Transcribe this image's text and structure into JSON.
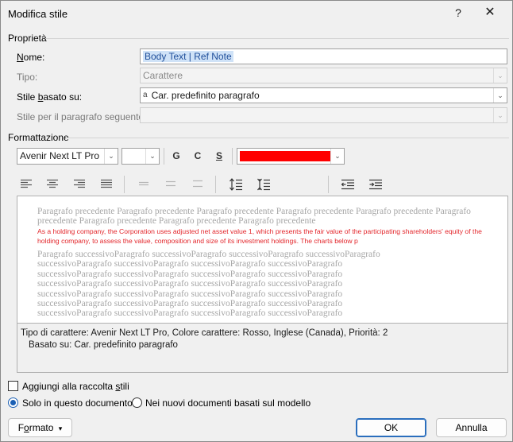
{
  "window": {
    "title": "Modifica stile",
    "help_glyph": "?",
    "close_glyph": "✕"
  },
  "properties": {
    "section": "Proprietà",
    "name_label": "Nome:",
    "name_value": "Body Text | Ref Note",
    "type_label": "Tipo:",
    "type_value": "Carattere",
    "based_label_pre": "Stile ",
    "based_label_u": "b",
    "based_label_post": "asato su:",
    "based_glyph": "a",
    "based_value": "Car. predefinito paragrafo",
    "next_label": "Stile per il paragrafo seguente:",
    "next_value": ""
  },
  "formatting": {
    "section": "Formattazione",
    "font": "Avenir Next LT Pro",
    "size": "",
    "bold": "G",
    "italic": "C",
    "underline": "S",
    "color": "#ff0000",
    "accent": "#1a5fb4"
  },
  "preview": {
    "prev_text": "Paragrafo precedente Paragrafo precedente Paragrafo precedente Paragrafo precedente Paragrafo precedente Paragrafo precedente Paragrafo precedente Paragrafo precedente Paragrafo precedente",
    "sample_text": "As a holding company, the Corporation uses adjusted net asset value 1, which presents the fair value of the participating shareholders' equity of the holding company, to assess the value, composition and size of its investment holdings. The charts below p",
    "next_lines": [
      "Paragrafo successivoParagrafo successivoParagrafo successivoParagrafo successivoParagrafo",
      "successivoParagrafo successivoParagrafo successivoParagrafo successivoParagrafo",
      "successivoParagrafo successivoParagrafo successivoParagrafo successivoParagrafo",
      "successivoParagrafo successivoParagrafo successivoParagrafo successivoParagrafo",
      "successivoParagrafo successivoParagrafo successivoParagrafo successivoParagrafo",
      "successivoParagrafo successivoParagrafo successivoParagrafo successivoParagrafo",
      "successivoParagrafo successivoParagrafo successivoParagrafo successivoParagrafo"
    ]
  },
  "description": {
    "line1": "Tipo di carattere: Avenir Next LT Pro, Colore carattere: Rosso, Inglese (Canada), Priorità: 2",
    "line2": "Basato su: Car. predefinito paragrafo"
  },
  "options": {
    "add_gallery_pre": "Aggiungi alla raccolta ",
    "add_gallery_u": "s",
    "add_gallery_post": "tili",
    "add_gallery_checked": false,
    "only_doc": "Solo in questo documento",
    "new_docs": "Nei nuovi documenti basati sul modello",
    "selected": "only_doc"
  },
  "buttons": {
    "format_pre": "F",
    "format_u": "o",
    "format_post": "rmato",
    "format_arrow": "▾",
    "ok": "OK",
    "cancel": "Annulla"
  },
  "icons": {
    "dropdown": "chevron-down-icon",
    "align": [
      "align-left-icon",
      "align-center-icon",
      "align-right-icon",
      "justify-icon"
    ],
    "spacing": [
      "single-spacing-icon",
      "one-half-spacing-icon",
      "double-spacing-icon"
    ],
    "paragraph": [
      "increase-paragraph-spacing-icon",
      "decrease-paragraph-spacing-icon"
    ],
    "indent": [
      "decrease-indent-icon",
      "increase-indent-icon"
    ]
  }
}
